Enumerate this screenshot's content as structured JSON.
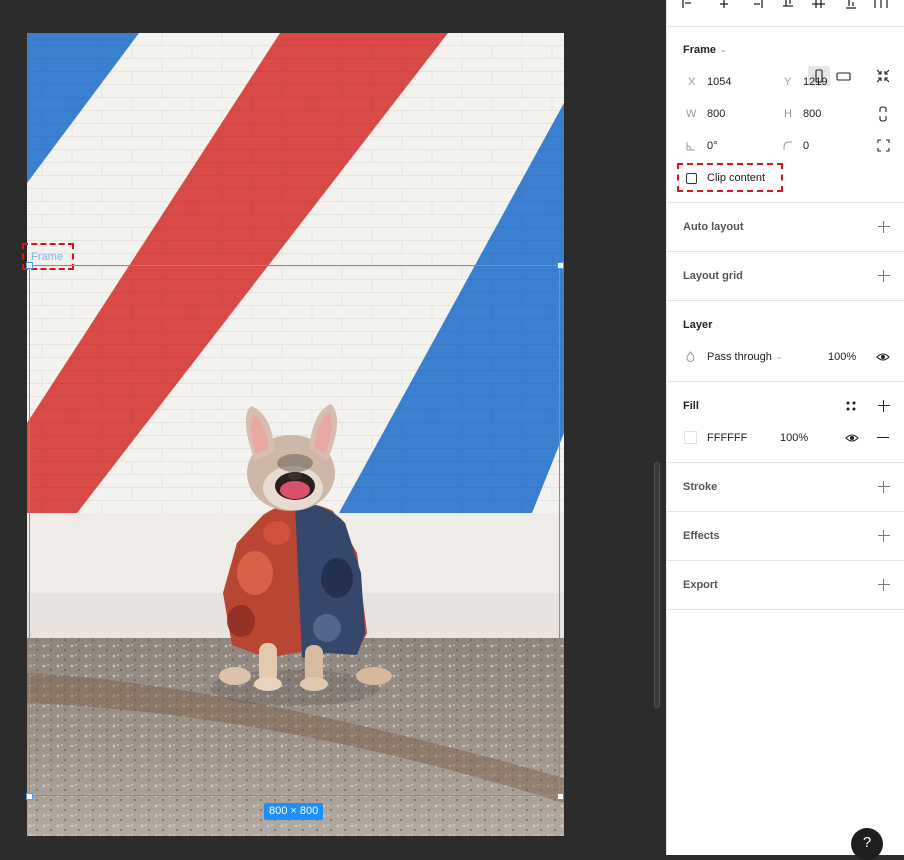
{
  "canvas": {
    "frame_label": "Frame",
    "size_badge": "800 × 800"
  },
  "panel": {
    "frame": {
      "title": "Frame",
      "x_label": "X",
      "x_value": "1054",
      "y_label": "Y",
      "y_value": "1219",
      "w_label": "W",
      "w_value": "800",
      "h_label": "H",
      "h_value": "800",
      "rotation_value": "0°",
      "radius_value": "0",
      "clip_content_label": "Clip content",
      "clip_content_checked": false
    },
    "auto_layout": {
      "title": "Auto layout"
    },
    "layout_grid": {
      "title": "Layout grid"
    },
    "layer": {
      "title": "Layer",
      "blend_mode": "Pass through",
      "opacity": "100%"
    },
    "fill": {
      "title": "Fill",
      "hex": "FFFFFF",
      "opacity": "100%",
      "color": "#FFFFFF"
    },
    "stroke": {
      "title": "Stroke"
    },
    "effects": {
      "title": "Effects"
    },
    "export": {
      "title": "Export"
    },
    "help_label": "?"
  },
  "colors": {
    "selection": "#4a9cf0",
    "badge": "#1f8ef5",
    "annotation": "#d9141b",
    "stripe_red": "#d94a47",
    "stripe_blue": "#3b7fd1"
  }
}
